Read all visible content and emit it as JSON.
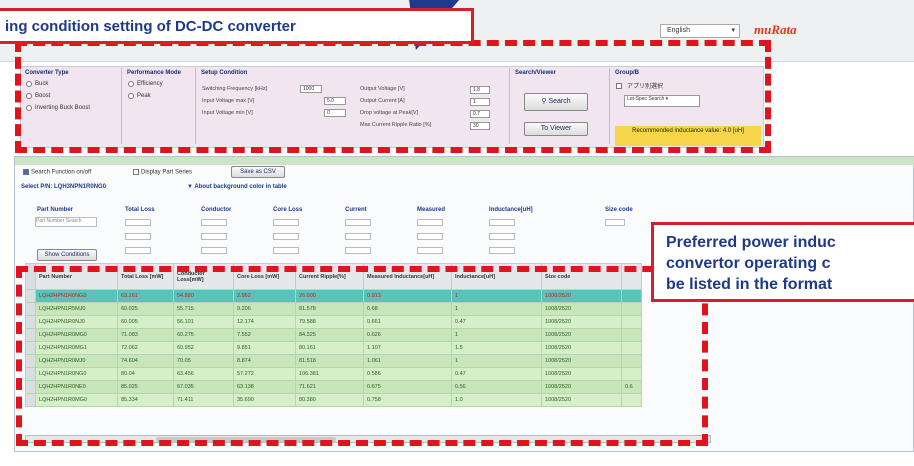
{
  "header": {
    "language": "English",
    "logo": "muRata",
    "arrow": "▾"
  },
  "callouts": {
    "top": "ing condition setting of DC-DC converter",
    "right_lines": [
      "Preferred power induc",
      "convertor operating c",
      "be listed in the format"
    ]
  },
  "controls": {
    "converter_type": {
      "title": "Converter Type",
      "options": [
        "Buck",
        "Boost",
        "Inverting Buck Boost"
      ]
    },
    "performance_mode": {
      "title": "Performance Mode",
      "options": [
        "Efficiency",
        "Peak"
      ]
    },
    "setup": {
      "title": "Setup Condition",
      "fields": [
        {
          "label": "Switching Frequency [kHz]",
          "value": "1000"
        },
        {
          "label": "Input Voltage max [V]",
          "value": "5.0"
        },
        {
          "label": "Input Voltage min [V]",
          "value": "0"
        }
      ]
    },
    "output": {
      "fields": [
        {
          "label": "Output Voltage [V]",
          "value": "1.8"
        },
        {
          "label": "Output Current [A]",
          "value": "1"
        },
        {
          "label": "Drop voltage at Peak[V]",
          "value": "0.7"
        },
        {
          "label": "Max Current Ripple Ratio [%]",
          "value": "30"
        }
      ]
    },
    "search": {
      "title": "Search/Viewer",
      "search_label": "Search",
      "viewer_label": "To Viewer"
    },
    "group": {
      "title": "Group/B",
      "check": "アプリ別選択",
      "select": "Lot-Spec Search"
    },
    "recommended": "Recommended inductance value: 4.0 [uH]"
  },
  "toolbar": {
    "check1": "Search Function on/off",
    "check2": "Display Part Series",
    "save": "Save as CSV",
    "selected": "Select P/N: LQH3NPN1R0NG0",
    "hint": "▼ About background color in table"
  },
  "filters": {
    "part_number": "Part Number",
    "placeholder": "Part Number Search",
    "show_conditions": "Show Conditions",
    "cols": [
      "Total Loss",
      "Conductor",
      "Core Loss",
      "Current",
      "Measured",
      "Inductance[uH]",
      "Size code"
    ]
  },
  "table": {
    "headers": [
      "Part Number",
      "Total Loss [mW]",
      "Conductor Loss[mW]",
      "Core Loss [mW]",
      "Current Ripple[%]",
      "Measured Inductance[uH]",
      "Inductance[uH]",
      "Size code"
    ],
    "rows": [
      [
        "LQH2HPN1R0NG0",
        "63.261",
        "54.880",
        "2.962",
        "26.000",
        "0.913",
        "1",
        "1008/2520"
      ],
      [
        "LQH2HPN1R5MJ0",
        "60.025",
        "55.715",
        "9.206",
        "81.578",
        "0.68",
        "1",
        "1008/2520"
      ],
      [
        "LQH2HPN1R0NJ0",
        "60.005",
        "56.101",
        "12.174",
        "79.588",
        "0.661",
        "0.47",
        "1008/2520"
      ],
      [
        "LQH2HPN1R0MG0",
        "71.083",
        "60.275",
        "7.552",
        "84.325",
        "0.626",
        "1",
        "1008/2520"
      ],
      [
        "LQH2HPN1R0MG1",
        "72.062",
        "60.952",
        "9.851",
        "80.161",
        "1.107",
        "1.5",
        "1008/2520"
      ],
      [
        "LQH2HPN1R0MJ0",
        "74.604",
        "70.05",
        "8.874",
        "81.518",
        "1.061",
        "1",
        "1008/2520"
      ],
      [
        "LQH2HPN1R0NG0",
        "80.04",
        "63.456",
        "57.272",
        "106.381",
        "0.586",
        "0.47",
        "1008/2520"
      ],
      [
        "LQH2HPN1R0NE0",
        "85.025",
        "67.035",
        "63.138",
        "71.621",
        "0.675",
        "0.56",
        "1008/2520"
      ],
      [
        "LQH2HPN1R0MG0",
        "85.334",
        "71.411",
        "35.690",
        "80.380",
        "0.758",
        "1.0",
        "1008/2520"
      ]
    ],
    "side_values": [
      "",
      "",
      "",
      "",
      "",
      "",
      "",
      "0.6",
      ""
    ]
  }
}
